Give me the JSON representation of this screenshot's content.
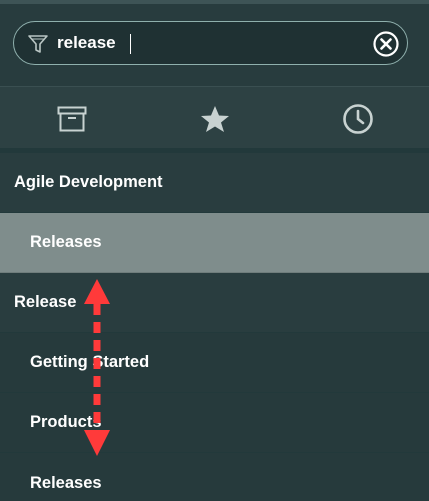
{
  "filter": {
    "value": "release",
    "icon": "funnel-icon",
    "clear_icon": "clear-circle-x-icon"
  },
  "tabs": [
    {
      "icon": "archive-box-icon",
      "name": "all-applications"
    },
    {
      "icon": "star-icon",
      "name": "favorites"
    },
    {
      "icon": "clock-icon",
      "name": "history"
    }
  ],
  "menu": {
    "section1": "Agile Development",
    "section1_item1": "Releases",
    "section2": "Release",
    "section2_item1": "Getting Started",
    "section2_item2": "Products",
    "section2_item3": "Releases"
  },
  "annotation": {
    "type": "double-headed-dashed-arrow",
    "color": "#ff3a3a"
  },
  "colors": {
    "background": "#293d3f",
    "selected_row": "#7f8d8c",
    "filter_border": "#8fb0ad",
    "text": "#ffffff"
  }
}
